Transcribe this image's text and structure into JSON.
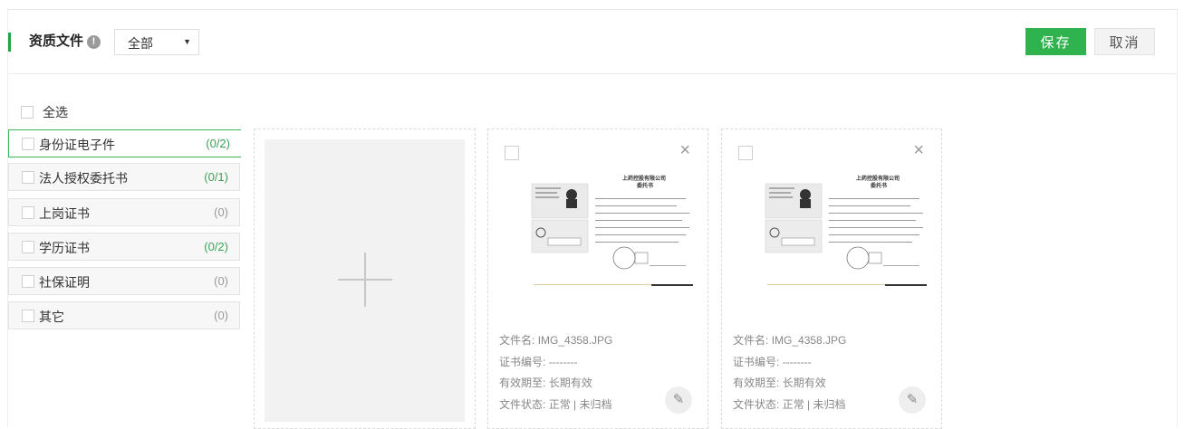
{
  "header": {
    "title": "资质文件",
    "info_icon": "info-icon",
    "filter": {
      "selected": "全部",
      "arrow": "▼"
    },
    "save_label": "保存",
    "cancel_label": "取消"
  },
  "select_all_label": "全选",
  "categories": [
    {
      "name": "身份证电子件",
      "count": "(0/2)"
    },
    {
      "name": "法人授权委托书",
      "count": "(0/1)"
    },
    {
      "name": "上岗证书",
      "count": "(0)"
    },
    {
      "name": "学历证书",
      "count": "(0/2)"
    },
    {
      "name": "社保证明",
      "count": "(0)"
    },
    {
      "name": "其它",
      "count": "(0)"
    }
  ],
  "files": [
    {
      "filename_label": "文件名:",
      "filename": "IMG_4358.JPG",
      "cert_label": "证书编号:",
      "cert_no": "--------",
      "valid_label": "有效期至:",
      "valid": "长期有效",
      "status_label": "文件状态:",
      "status": "正常 | 未归档",
      "doc_title": "上药控股有限公司",
      "doc_subtitle": "委托书"
    },
    {
      "filename_label": "文件名:",
      "filename": "IMG_4358.JPG",
      "cert_label": "证书编号:",
      "cert_no": "--------",
      "valid_label": "有效期至:",
      "valid": "长期有效",
      "status_label": "文件状态:",
      "status": "正常 | 未归档",
      "doc_title": "上药控股有限公司",
      "doc_subtitle": "委托书"
    }
  ],
  "colors": {
    "accent": "#2fb34f",
    "count_green": "#3aa156"
  }
}
